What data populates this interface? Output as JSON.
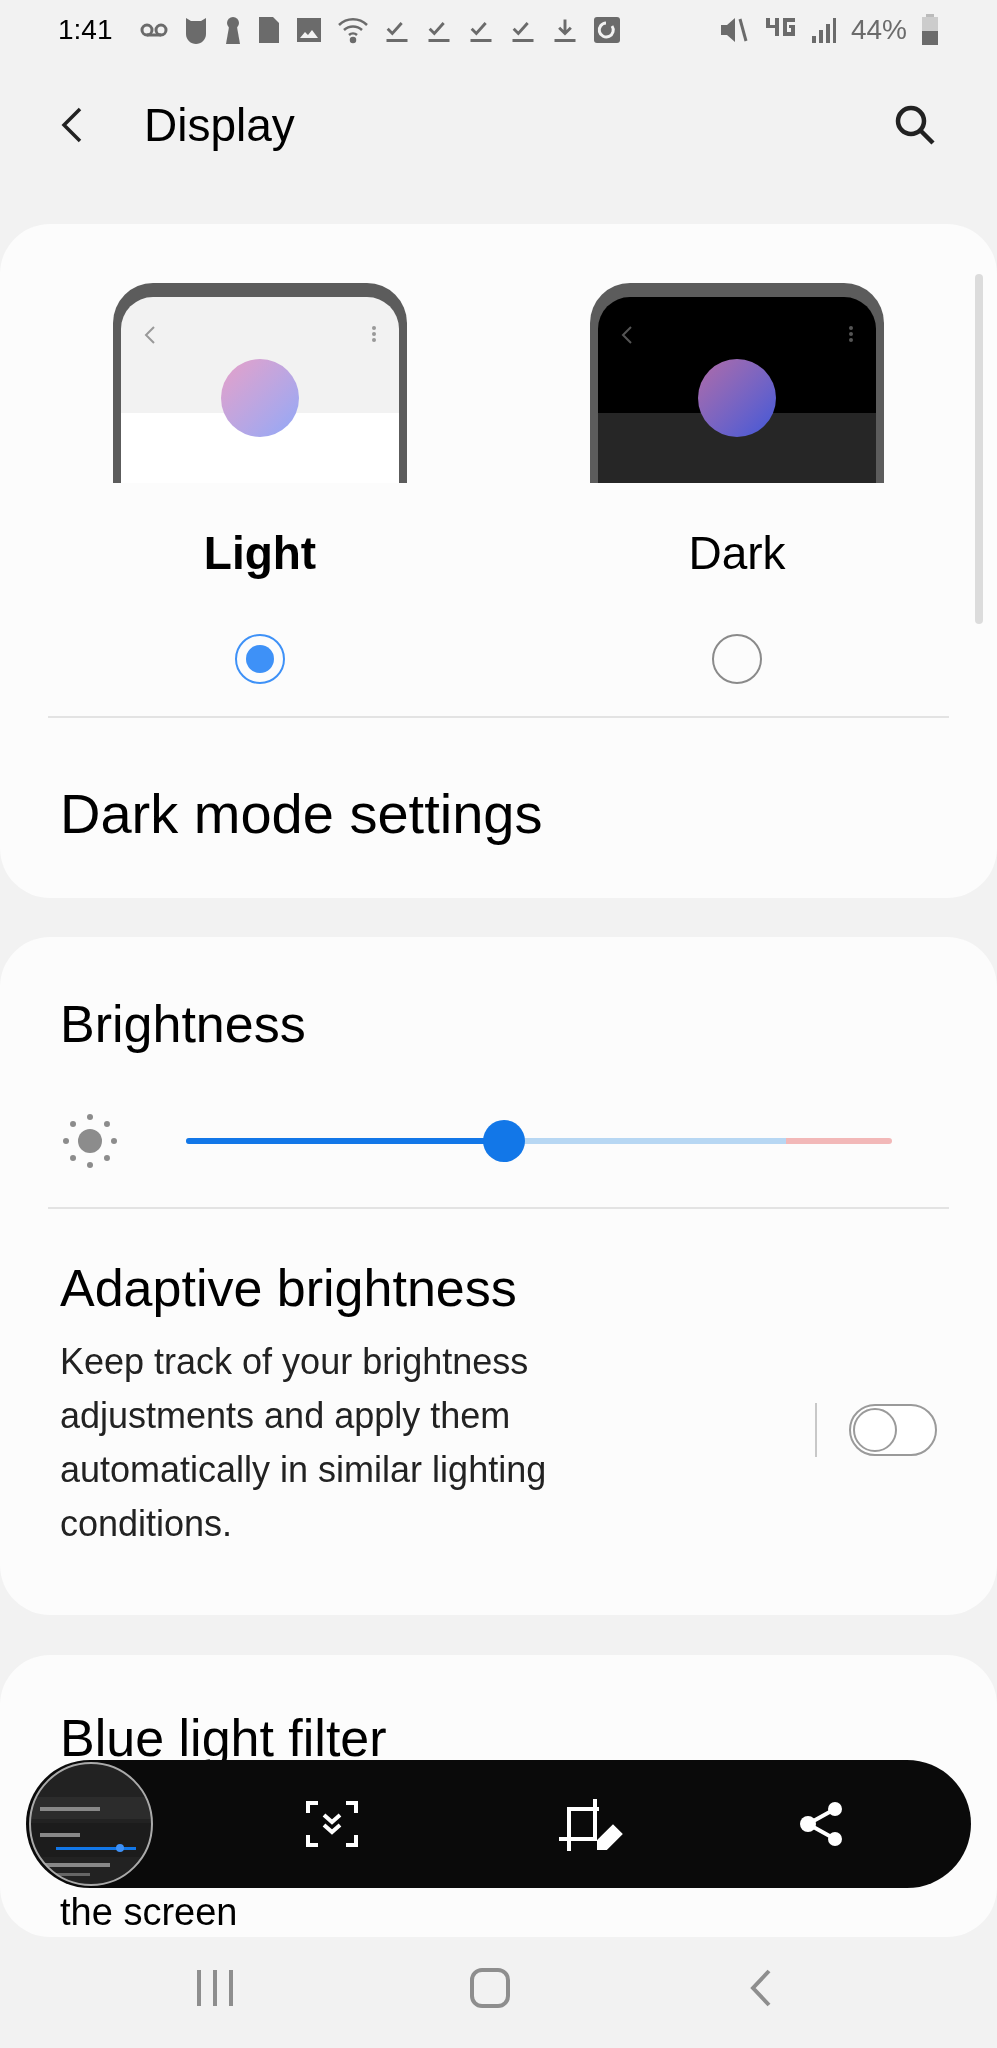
{
  "status_bar": {
    "time": "1:41",
    "battery": "44%"
  },
  "header": {
    "title": "Display"
  },
  "theme_options": [
    {
      "label": "Light",
      "kind": "light",
      "selected": true
    },
    {
      "label": "Dark",
      "kind": "dark",
      "selected": false
    }
  ],
  "dark_mode_settings": "Dark mode settings",
  "brightness": {
    "title": "Brightness",
    "level": 0.45
  },
  "adaptive_brightness": {
    "title": "Adaptive brightness",
    "description": "Keep track of your brightness adjustments and apply them automatically in similar lighting conditions.",
    "on": false
  },
  "blue_light_filter": {
    "title": "Blue light filter",
    "description": "the screen"
  }
}
